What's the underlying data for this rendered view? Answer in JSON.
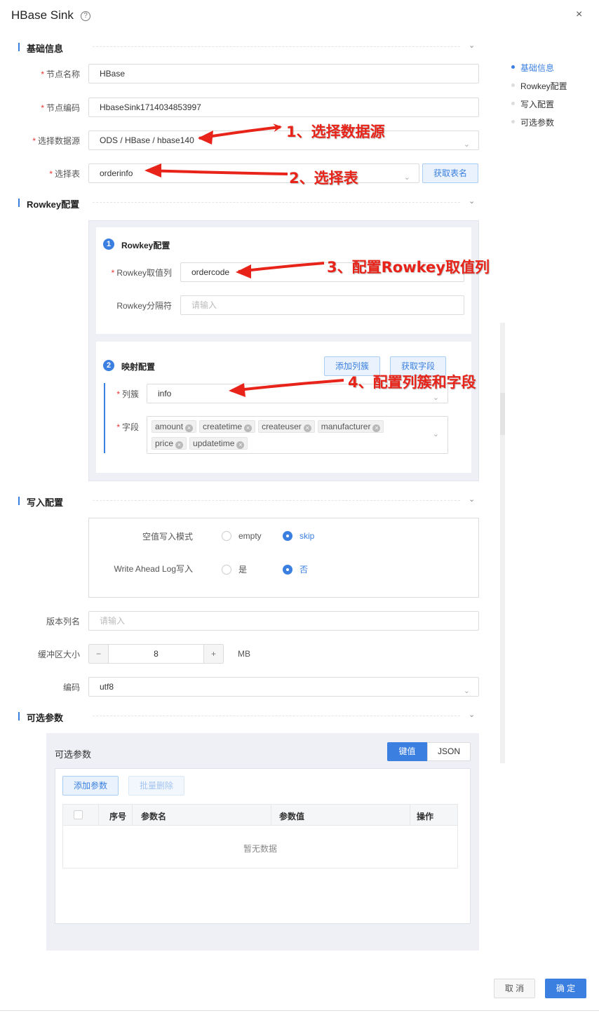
{
  "dialog": {
    "title": "HBase Sink",
    "help_glyph": "?",
    "close_glyph": "×",
    "cancel_label": "取 消",
    "confirm_label": "确 定"
  },
  "nav": {
    "items": [
      {
        "label": "基础信息",
        "active": true
      },
      {
        "label": "Rowkey配置",
        "active": false
      },
      {
        "label": "写入配置",
        "active": false
      },
      {
        "label": "可选参数",
        "active": false
      }
    ]
  },
  "basic": {
    "section_title": "基础信息",
    "node_name_label": "节点名称",
    "node_name_value": "HBase",
    "node_code_label": "节点编码",
    "node_code_value": "HbaseSink1714034853997",
    "datasource_label": "选择数据源",
    "datasource_value": "ODS / HBase / hbase140",
    "table_label": "选择表",
    "table_value": "orderinfo",
    "get_table_button": "获取表名"
  },
  "rowkey": {
    "section_title": "Rowkey配置",
    "card1_title": "Rowkey配置",
    "card1_step": "1",
    "value_col_label": "Rowkey取值列",
    "value_col_value": "ordercode",
    "separator_label": "Rowkey分隔符",
    "separator_placeholder": "请输入",
    "card2_title": "映射配置",
    "card2_step": "2",
    "add_family_button": "添加列簇",
    "get_fields_button": "获取字段",
    "family_label": "列簇",
    "family_value": "info",
    "fields_label": "字段",
    "fields": [
      "amount",
      "createtime",
      "createuser",
      "manufacturer",
      "price",
      "updatetime"
    ]
  },
  "write": {
    "section_title": "写入配置",
    "null_mode_label": "空值写入模式",
    "null_mode_options": [
      "empty",
      "skip"
    ],
    "null_mode_selected": "skip",
    "wal_label": "Write Ahead Log写入",
    "wal_options": [
      "是",
      "否"
    ],
    "wal_selected": "否",
    "version_col_label": "版本列名",
    "version_col_placeholder": "请输入",
    "buffer_label": "缓冲区大小",
    "buffer_value": "8",
    "buffer_unit": "MB",
    "minus_glyph": "−",
    "plus_glyph": "+",
    "encoding_label": "编码",
    "encoding_value": "utf8"
  },
  "optional": {
    "section_title": "可选参数",
    "panel_title": "可选参数",
    "tab_kv": "键值",
    "tab_json": "JSON",
    "add_param_button": "添加参数",
    "batch_delete_button": "批量删除",
    "columns": [
      "序号",
      "参数名",
      "参数值",
      "操作"
    ],
    "empty_text": "暂无数据"
  },
  "annotations": {
    "a1": "1、选择数据源",
    "a2": "2、选择表",
    "a3": "3、配置Rowkey取值列",
    "a4": "4、配置列簇和字段",
    "color": "#e8241a"
  },
  "colors": {
    "accent": "#3b7fe0",
    "required": "#e33"
  },
  "icons": {
    "chevron": "chevron-down-icon",
    "close": "close-icon",
    "help": "help-icon",
    "tag_remove": "tag-close-icon"
  }
}
